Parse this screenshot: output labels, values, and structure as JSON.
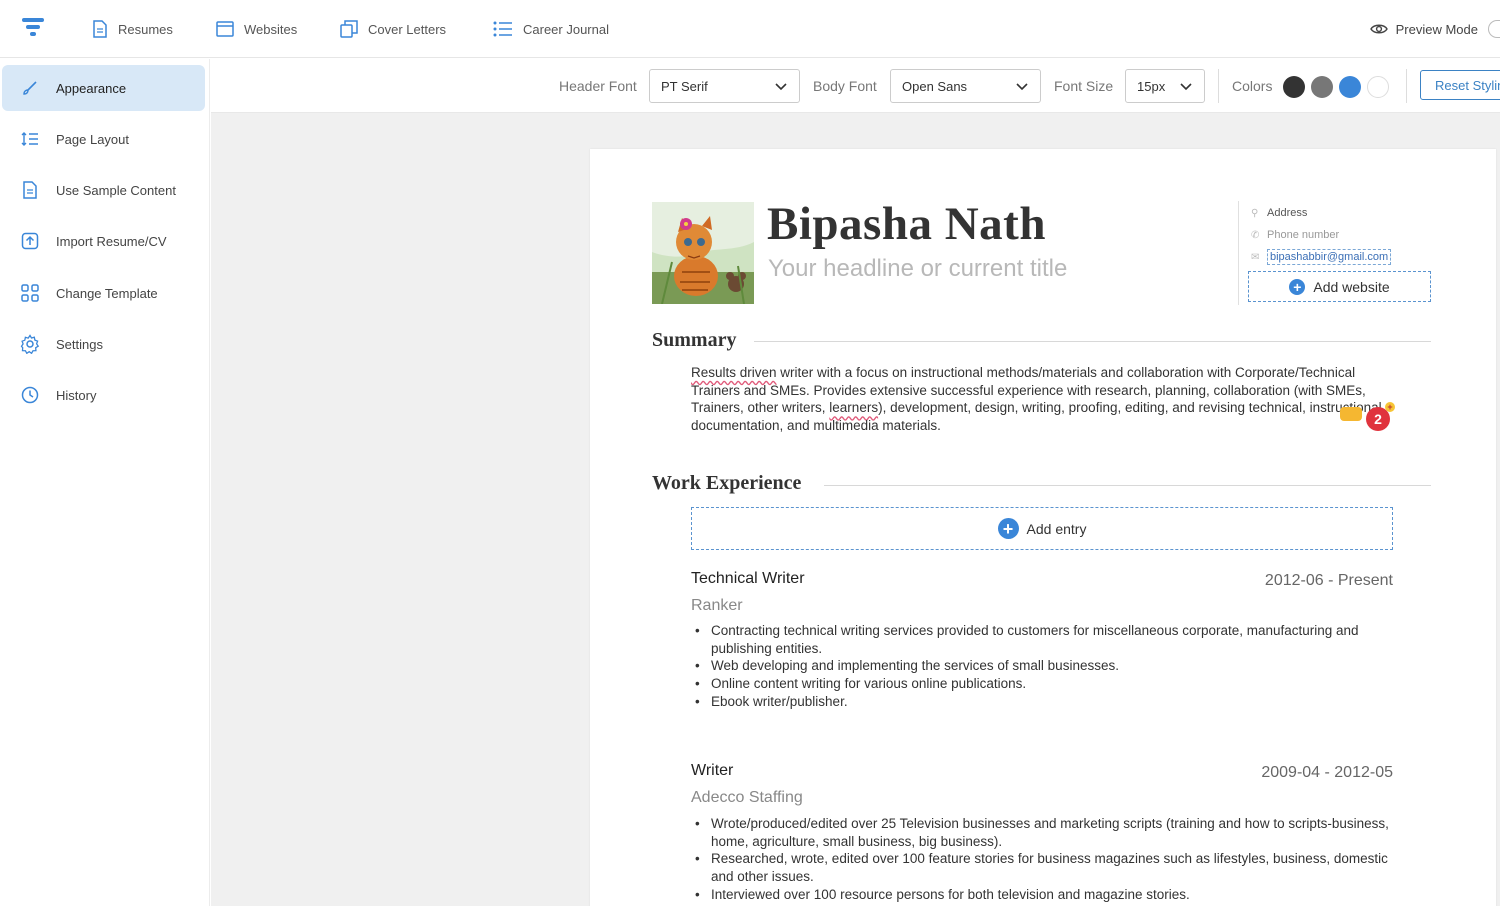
{
  "topnav": {
    "items": [
      {
        "label": "Resumes",
        "icon": "document-icon"
      },
      {
        "label": "Websites",
        "icon": "browser-window-icon"
      },
      {
        "label": "Cover Letters",
        "icon": "copy-icon"
      },
      {
        "label": "Career Journal",
        "icon": "list-icon"
      }
    ],
    "preview_label": "Preview Mode"
  },
  "sidebar": {
    "items": [
      {
        "label": "Appearance",
        "icon": "brush-icon",
        "active": true
      },
      {
        "label": "Page Layout",
        "icon": "layout-lines-icon"
      },
      {
        "label": "Use Sample Content",
        "icon": "sample-document-icon"
      },
      {
        "label": "Import Resume/CV",
        "icon": "upload-icon"
      },
      {
        "label": "Change Template",
        "icon": "grid-icon"
      },
      {
        "label": "Settings",
        "icon": "gear-icon"
      },
      {
        "label": "History",
        "icon": "clock-icon"
      }
    ]
  },
  "toolbar": {
    "header_font_label": "Header Font",
    "header_font_value": "PT Serif",
    "body_font_label": "Body Font",
    "body_font_value": "Open Sans",
    "font_size_label": "Font Size",
    "font_size_value": "15px",
    "colors_label": "Colors",
    "colors": [
      "#333333",
      "#777777",
      "#3a86d8",
      "#ffffff"
    ],
    "reset_label": "Reset Styling"
  },
  "resume": {
    "name": "Bipasha Nath",
    "headline_placeholder": "Your headline or current title",
    "contact": {
      "address_placeholder": "Address",
      "phone_placeholder": "Phone number",
      "email": "bipashabbir@gmail.com",
      "add_website_label": "Add website"
    },
    "summary_title": "Summary",
    "summary_parts": {
      "p1": "Results driven",
      "p2": " writer with a focus on instructional methods/materials and collaboration with Corporate/Technical Trainers and SMEs. Provides extensive successful experience with research, planning, collaboration (with SMEs, Trainers, other writers, ",
      "p3": "learners",
      "p4": "), development, design, writing, proofing, editing, and revising technical, instructional documentation, and multimedia materials."
    },
    "badge_count": "2",
    "work_title": "Work Experience",
    "add_entry_label": "Add entry",
    "jobs": [
      {
        "title": "Technical Writer",
        "dates": "2012-06 - Present",
        "company": "Ranker",
        "bullets": [
          "Contracting technical writing services provided to customers for miscellaneous corporate, manufacturing and publishing entities.",
          "Web developing and implementing the services of small businesses.",
          "Online content writing for various online publications.",
          "Ebook writer/publisher."
        ]
      },
      {
        "title": "Writer",
        "dates": "2009-04 - 2012-05",
        "company": "Adecco Staffing",
        "bullets": [
          "Wrote/produced/edited over 25 Television businesses and marketing scripts (training and how to scripts-business, home, agriculture, small business, big business).",
          "Researched, wrote, edited over 100 feature stories for business magazines such as lifestyles, business, domestic and other issues.",
          "Interviewed over 100 resource persons for both television and magazine stories."
        ]
      }
    ]
  }
}
